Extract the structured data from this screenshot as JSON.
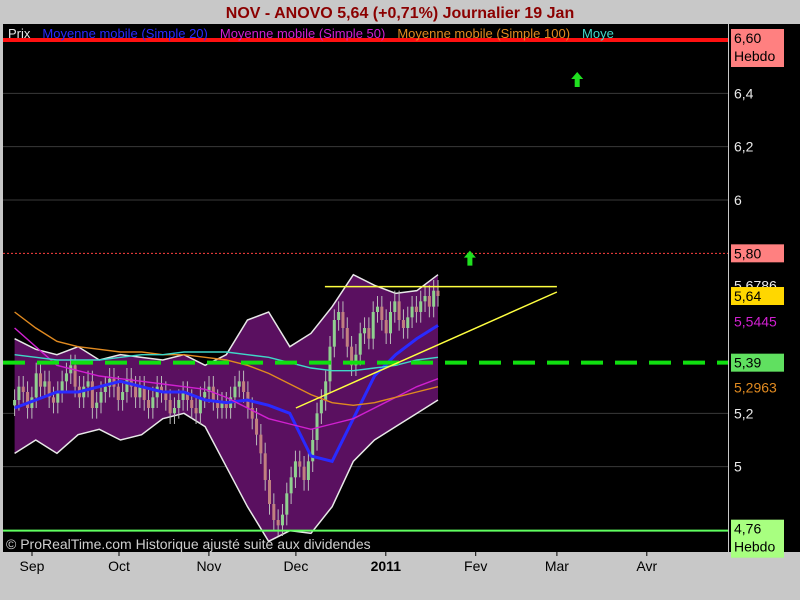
{
  "header": {
    "title": "NOV - ANOVO     5,64 (+0,71%)     Journalier  19 Jan"
  },
  "legend": [
    {
      "label": "Prix",
      "color": "#e8e8e8"
    },
    {
      "label": "Moyenne mobile (Simple 20)",
      "color": "#2a2aff"
    },
    {
      "label": "Moyenne mobile (Simple 50)",
      "color": "#d020d0"
    },
    {
      "label": "Moyenne mobile (Simple 100)",
      "color": "#e08a20"
    },
    {
      "label": "Moye",
      "color": "#40d8c8"
    }
  ],
  "watermark": "© ProRealTime.com Historique ajusté suite aux dividendes",
  "colors": {
    "background": "#000000",
    "band_fill": "#5a1060",
    "band_edge": "#e8e8e8",
    "candle_up": "#90d090",
    "candle_down": "#c08080",
    "resistance": "#ff1010",
    "support_green": "#60ff60",
    "dashed_green": "#10e010",
    "dotted_red": "#ff4040",
    "trend_yellow": "#ffff40",
    "arrow_green": "#20e020"
  },
  "chart_data": {
    "type": "candlestick",
    "instrument": "NOV - ANOVO",
    "timeframe": "Journalier",
    "last_price": 5.64,
    "change_pct": 0.71,
    "ylim": [
      4.68,
      6.66
    ],
    "y_ticks": [
      {
        "value": 6.4,
        "label": "6,4"
      },
      {
        "value": 6.2,
        "label": "6,2"
      },
      {
        "value": 6.0,
        "label": "6"
      },
      {
        "value": 5.2,
        "label": "5,2"
      },
      {
        "value": 5.0,
        "label": "5"
      }
    ],
    "x_ticks": [
      {
        "label": "Sep",
        "date": "2010-09-01"
      },
      {
        "label": "Oct",
        "date": "2010-10-01"
      },
      {
        "label": "Nov",
        "date": "2010-11-01"
      },
      {
        "label": "Dec",
        "date": "2010-12-01"
      },
      {
        "label": "2011",
        "date": "2011-01-01",
        "bold": true
      },
      {
        "label": "Fev",
        "date": "2011-02-01"
      },
      {
        "label": "Mar",
        "date": "2011-03-01"
      },
      {
        "label": "Avr",
        "date": "2011-04-01"
      }
    ],
    "price_tags": [
      {
        "value": 6.6,
        "label": "6,60",
        "sub": "Hebdo",
        "bg": "#ff8080",
        "fg": "#000000"
      },
      {
        "value": 5.8,
        "label": "5,80",
        "sub": "",
        "bg": "#ff8080",
        "fg": "#000000"
      },
      {
        "value": 5.6786,
        "label": "5,6786",
        "sub": "",
        "bg": "#000000",
        "fg": "#eaeaea"
      },
      {
        "value": 5.64,
        "label": "5,64",
        "sub": "",
        "bg": "#ffd700",
        "fg": "#000000"
      },
      {
        "value": 5.5445,
        "label": "5,5445",
        "sub": "",
        "bg": "#000000",
        "fg": "#d020d0"
      },
      {
        "value": 5.39,
        "label": "5,39",
        "sub": "",
        "bg": "#60e060",
        "fg": "#000000"
      },
      {
        "value": 5.2963,
        "label": "5,2963",
        "sub": "",
        "bg": "#000000",
        "fg": "#e08a20"
      },
      {
        "value": 4.76,
        "label": "4,76",
        "sub": "Hebdo",
        "bg": "#a8ff80",
        "fg": "#000000"
      }
    ],
    "horizontal_lines": [
      {
        "value": 6.6,
        "style": "solid",
        "color": "#ff1010"
      },
      {
        "value": 5.8,
        "style": "dotted",
        "color": "#ff4040"
      },
      {
        "value": 5.39,
        "style": "dashed",
        "color": "#10e010"
      },
      {
        "value": 4.76,
        "style": "solid",
        "color": "#60ff60"
      }
    ],
    "trendlines": [
      {
        "start": {
          "date": "2010-12-11",
          "value": 5.675
        },
        "end": {
          "date": "2011-03-01",
          "value": 5.675
        }
      },
      {
        "start": {
          "date": "2010-12-01",
          "value": 5.22
        },
        "end": {
          "date": "2011-03-01",
          "value": 5.655
        }
      }
    ],
    "arrows": [
      {
        "date": "2011-03-08",
        "value": 6.45,
        "direction": "up"
      },
      {
        "date": "2011-01-30",
        "value": 5.78,
        "direction": "up"
      }
    ],
    "series": [
      {
        "name": "Prix",
        "type": "candles",
        "x_start": "2010-08-26",
        "x_end": "2011-01-19",
        "close": [
          5.25,
          5.3,
          5.28,
          5.22,
          5.26,
          5.35,
          5.3,
          5.32,
          5.26,
          5.24,
          5.28,
          5.32,
          5.35,
          5.38,
          5.3,
          5.26,
          5.3,
          5.32,
          5.22,
          5.24,
          5.28,
          5.3,
          5.33,
          5.3,
          5.25,
          5.28,
          5.33,
          5.3,
          5.26,
          5.3,
          5.25,
          5.22,
          5.26,
          5.3,
          5.28,
          5.25,
          5.2,
          5.22,
          5.25,
          5.28,
          5.25,
          5.22,
          5.2,
          5.26,
          5.28,
          5.3,
          5.25,
          5.22,
          5.24,
          5.22,
          5.26,
          5.3,
          5.32,
          5.28,
          5.22,
          5.18,
          5.12,
          5.05,
          4.95,
          4.86,
          4.8,
          4.78,
          4.82,
          4.9,
          4.96,
          5.02,
          5.0,
          4.95,
          5.02,
          5.1,
          5.2,
          5.25,
          5.32,
          5.45,
          5.55,
          5.58,
          5.52,
          5.45,
          5.38,
          5.42,
          5.5,
          5.52,
          5.48,
          5.58,
          5.6,
          5.55,
          5.5,
          5.58,
          5.62,
          5.55,
          5.52,
          5.56,
          5.6,
          5.58,
          5.62,
          5.64,
          5.6,
          5.66,
          5.64
        ]
      },
      {
        "name": "Moyenne mobile (Simple 20)",
        "type": "line",
        "color": "#2a2aff",
        "values": [
          5.22,
          5.25,
          5.28,
          5.28,
          5.3,
          5.32,
          5.3,
          5.28,
          5.28,
          5.25,
          5.24,
          5.25,
          5.23,
          5.2,
          5.04,
          5.02,
          5.18,
          5.34,
          5.42,
          5.48,
          5.53
        ]
      },
      {
        "name": "Moyenne mobile (Simple 50)",
        "type": "line",
        "color": "#d020d0",
        "values": [
          5.52,
          5.45,
          5.38,
          5.36,
          5.34,
          5.33,
          5.32,
          5.31,
          5.3,
          5.29,
          5.26,
          5.22,
          5.18,
          5.16,
          5.14,
          5.16,
          5.18,
          5.22,
          5.26,
          5.3,
          5.33
        ]
      },
      {
        "name": "Moyenne mobile (Simple 100)",
        "type": "line",
        "color": "#e08a20",
        "values": [
          5.58,
          5.52,
          5.47,
          5.45,
          5.44,
          5.43,
          5.43,
          5.42,
          5.42,
          5.41,
          5.4,
          5.38,
          5.35,
          5.31,
          5.27,
          5.24,
          5.23,
          5.24,
          5.26,
          5.28,
          5.3
        ]
      },
      {
        "name": "Moye",
        "type": "line",
        "color": "#40d8c8",
        "values": [
          5.42,
          5.41,
          5.4,
          5.4,
          5.4,
          5.41,
          5.42,
          5.42,
          5.43,
          5.43,
          5.43,
          5.42,
          5.41,
          5.39,
          5.37,
          5.36,
          5.36,
          5.37,
          5.38,
          5.4,
          5.41
        ]
      },
      {
        "name": "band_upper",
        "type": "band-edge",
        "values": [
          5.48,
          5.44,
          5.42,
          5.45,
          5.4,
          5.42,
          5.41,
          5.4,
          5.42,
          5.38,
          5.42,
          5.55,
          5.58,
          5.45,
          5.5,
          5.6,
          5.72,
          5.68,
          5.65,
          5.66,
          5.72
        ]
      },
      {
        "name": "band_lower",
        "type": "band-edge",
        "values": [
          5.05,
          5.1,
          5.05,
          5.12,
          5.14,
          5.1,
          5.12,
          5.18,
          5.2,
          5.15,
          5.0,
          4.85,
          4.72,
          4.76,
          4.75,
          4.85,
          5.02,
          5.1,
          5.15,
          5.2,
          5.25
        ]
      }
    ]
  }
}
